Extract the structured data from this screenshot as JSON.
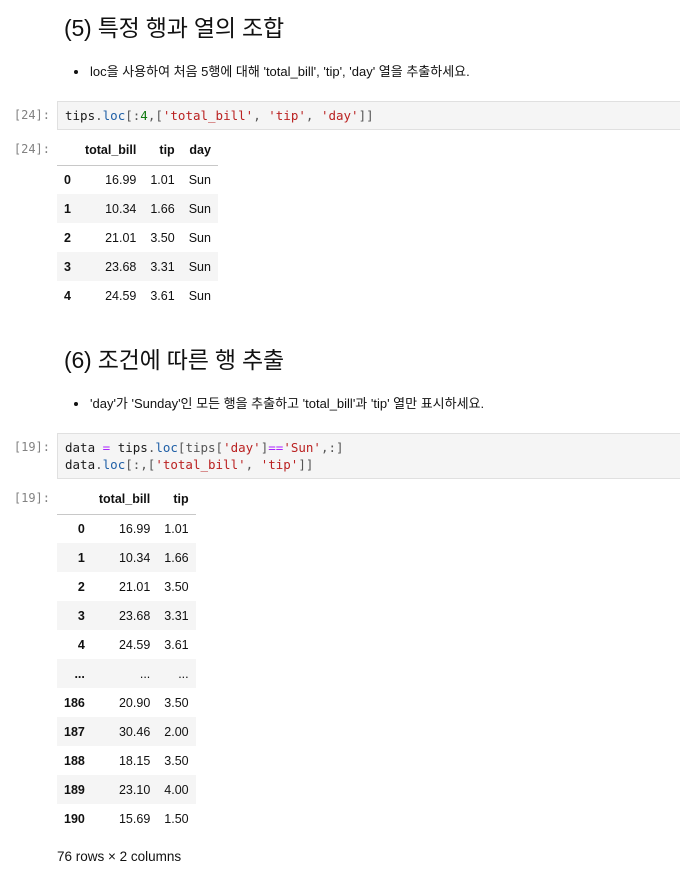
{
  "section5": {
    "heading": "(5) 특정 행과 열의 조합",
    "bullet": "loc을 사용하여 처음 5행에 대해 'total_bill', 'tip', 'day' 열을 추출하세요.",
    "cell": {
      "prompt_in": "[24]:",
      "prompt_out": "[24]:",
      "code_tokens": [
        {
          "t": "tips",
          "c": "tok-var"
        },
        {
          "t": ".",
          "c": "tok-punc"
        },
        {
          "t": "loc",
          "c": "tok-attr"
        },
        {
          "t": "[:",
          "c": "tok-punc"
        },
        {
          "t": "4",
          "c": "tok-num"
        },
        {
          "t": ",[",
          "c": "tok-punc"
        },
        {
          "t": "'total_bill'",
          "c": "tok-str"
        },
        {
          "t": ", ",
          "c": "tok-punc"
        },
        {
          "t": "'tip'",
          "c": "tok-str"
        },
        {
          "t": ", ",
          "c": "tok-punc"
        },
        {
          "t": "'day'",
          "c": "tok-str"
        },
        {
          "t": "]]",
          "c": "tok-punc"
        }
      ]
    },
    "table": {
      "columns": [
        "",
        "total_bill",
        "tip",
        "day"
      ],
      "rows": [
        [
          "0",
          "16.99",
          "1.01",
          "Sun"
        ],
        [
          "1",
          "10.34",
          "1.66",
          "Sun"
        ],
        [
          "2",
          "21.01",
          "3.50",
          "Sun"
        ],
        [
          "3",
          "23.68",
          "3.31",
          "Sun"
        ],
        [
          "4",
          "24.59",
          "3.61",
          "Sun"
        ]
      ]
    }
  },
  "section6": {
    "heading": "(6) 조건에 따른 행 추출",
    "bullet": "'day'가 'Sunday'인 모든 행을 추출하고 'total_bill'과 'tip' 열만 표시하세요.",
    "cell": {
      "prompt_in": "[19]:",
      "prompt_out": "[19]:",
      "code_lines": [
        [
          {
            "t": "data",
            "c": "tok-var"
          },
          {
            "t": " ",
            "c": "tok-punc"
          },
          {
            "t": "=",
            "c": "tok-op"
          },
          {
            "t": " ",
            "c": "tok-punc"
          },
          {
            "t": "tips",
            "c": "tok-var"
          },
          {
            "t": ".",
            "c": "tok-punc"
          },
          {
            "t": "loc",
            "c": "tok-attr"
          },
          {
            "t": "[tips[",
            "c": "tok-punc"
          },
          {
            "t": "'day'",
            "c": "tok-str"
          },
          {
            "t": "]",
            "c": "tok-punc"
          },
          {
            "t": "==",
            "c": "tok-op"
          },
          {
            "t": "'Sun'",
            "c": "tok-str"
          },
          {
            "t": ",:]",
            "c": "tok-punc"
          }
        ],
        [
          {
            "t": "data",
            "c": "tok-var"
          },
          {
            "t": ".",
            "c": "tok-punc"
          },
          {
            "t": "loc",
            "c": "tok-attr"
          },
          {
            "t": "[:,[",
            "c": "tok-punc"
          },
          {
            "t": "'total_bill'",
            "c": "tok-str"
          },
          {
            "t": ", ",
            "c": "tok-punc"
          },
          {
            "t": "'tip'",
            "c": "tok-str"
          },
          {
            "t": "]]",
            "c": "tok-punc"
          }
        ]
      ]
    },
    "table": {
      "columns": [
        "",
        "total_bill",
        "tip"
      ],
      "rows": [
        [
          "0",
          "16.99",
          "1.01"
        ],
        [
          "1",
          "10.34",
          "1.66"
        ],
        [
          "2",
          "21.01",
          "3.50"
        ],
        [
          "3",
          "23.68",
          "3.31"
        ],
        [
          "4",
          "24.59",
          "3.61"
        ],
        [
          "...",
          "...",
          "..."
        ],
        [
          "186",
          "20.90",
          "3.50"
        ],
        [
          "187",
          "30.46",
          "2.00"
        ],
        [
          "188",
          "18.15",
          "3.50"
        ],
        [
          "189",
          "23.10",
          "4.00"
        ],
        [
          "190",
          "15.69",
          "1.50"
        ]
      ]
    },
    "shape": "76 rows × 2 columns"
  }
}
